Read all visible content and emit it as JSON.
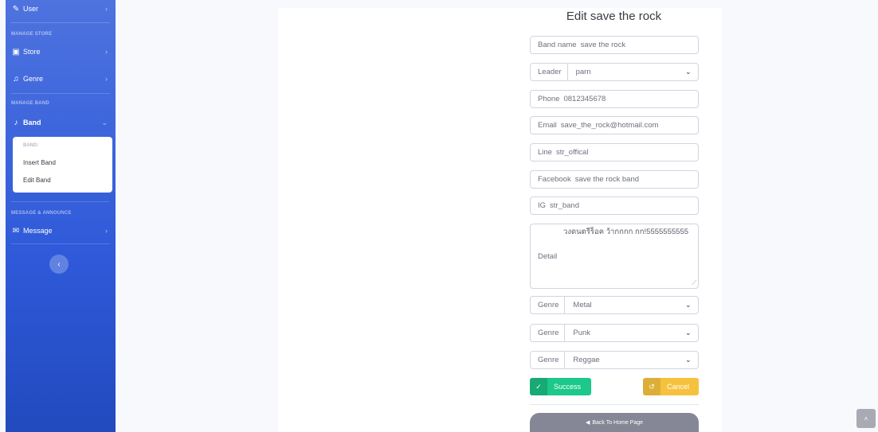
{
  "sidebar": {
    "user_label": "User",
    "heading_store": "MANAGE STORE",
    "store_label": "Store",
    "genre_label": "Genre",
    "heading_band": "MANAGE BAND",
    "band_label": "Band",
    "submenu": {
      "heading": "BAND:",
      "insert": "Insert Band",
      "edit": "Edit Band"
    },
    "heading_message": "MESSAGE & ANNOUNCE",
    "message_label": "Message"
  },
  "form": {
    "title": "Edit save the rock",
    "band_name": {
      "label": "Band name",
      "value": "save the rock"
    },
    "leader": {
      "label": "Leader",
      "value": "parn"
    },
    "phone": {
      "label": "Phone",
      "value": "0812345678"
    },
    "email": {
      "label": "Email",
      "value": "save_the_rock@hotmail.com"
    },
    "line": {
      "label": "Line",
      "value": "str_offical"
    },
    "facebook": {
      "label": "Facebook",
      "value": "save the rock band"
    },
    "ig": {
      "label": "IG",
      "value": "str_band"
    },
    "detail": {
      "label": "Detail",
      "value": "วงดนตรีร็อค ว้ากกกก กก!5555555555"
    },
    "genre1": {
      "label": "Genre",
      "value": "Metal"
    },
    "genre2": {
      "label": "Genre",
      "value": "Punk"
    },
    "genre3": {
      "label": "Genre",
      "value": "Reggae"
    },
    "success_label": "Success",
    "cancel_label": "Cancel",
    "home_label": "Back To Home Page"
  },
  "colors": {
    "sidebar": "#4e73df",
    "success": "#1cc88a",
    "warning": "#f6c23e",
    "secondary": "#858796"
  }
}
